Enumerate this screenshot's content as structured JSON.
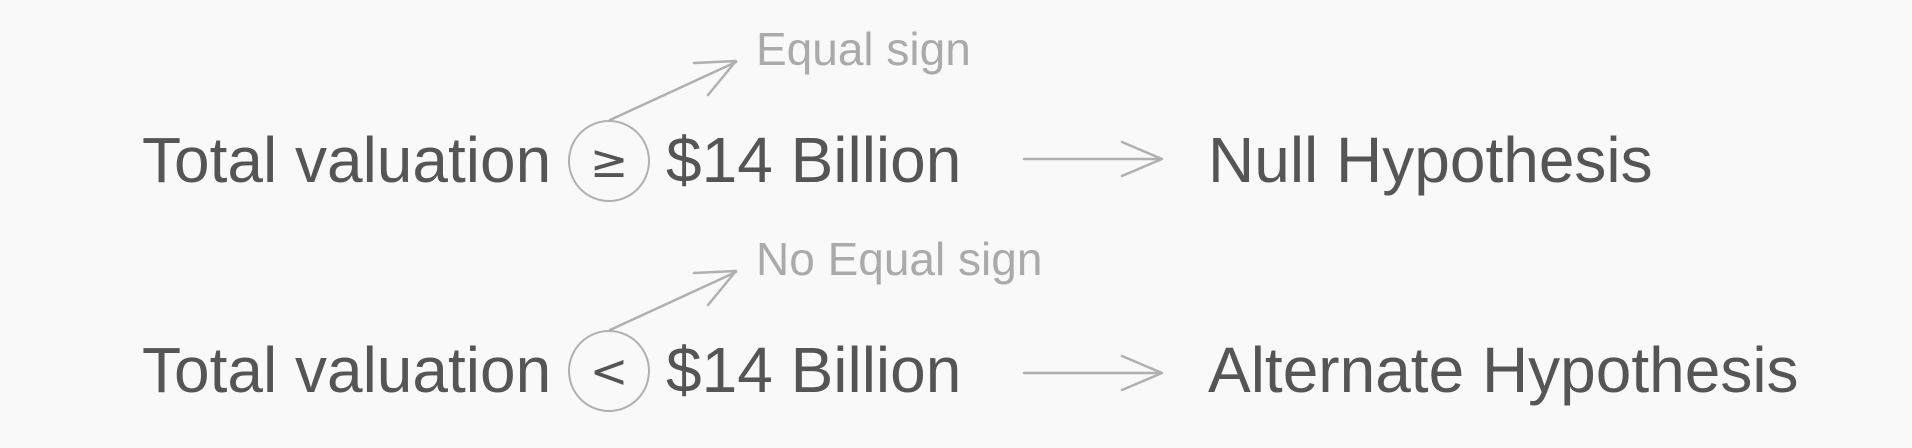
{
  "rows": [
    {
      "subject": "Total valuation",
      "operator": "≥",
      "value": "$14 Billion",
      "annotation": "Equal sign",
      "hypothesis": "Null Hypothesis"
    },
    {
      "subject": "Total valuation",
      "operator": "<",
      "value": "$14 Billion",
      "annotation": "No Equal sign",
      "hypothesis": "Alternate Hypothesis"
    }
  ],
  "colors": {
    "text": "#555555",
    "annotation": "#aaaaaa",
    "lines": "#b0b0b0",
    "background": "#f9f9f9"
  }
}
